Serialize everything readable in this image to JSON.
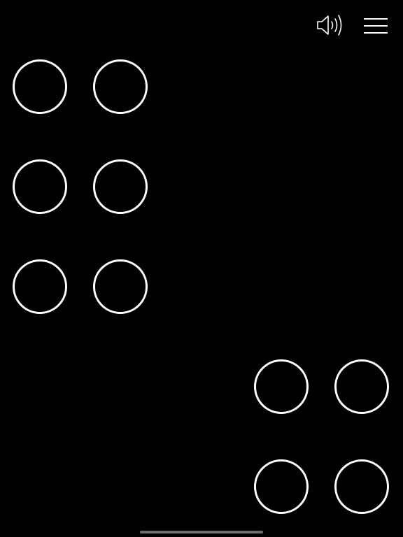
{
  "colors": {
    "background": "#000000",
    "dot_outline": "#ffffff",
    "icon": "#ffffff",
    "home_indicator": "#6e6e6e"
  },
  "toolbar": {
    "sound_icon": "speaker-volume-icon",
    "menu_icon": "hamburger-menu-icon"
  },
  "braille": {
    "cell_1": {
      "dots": [
        false,
        false,
        false,
        false,
        false,
        false
      ]
    },
    "cell_2": {
      "dots": [
        false,
        false,
        false,
        false
      ]
    }
  }
}
